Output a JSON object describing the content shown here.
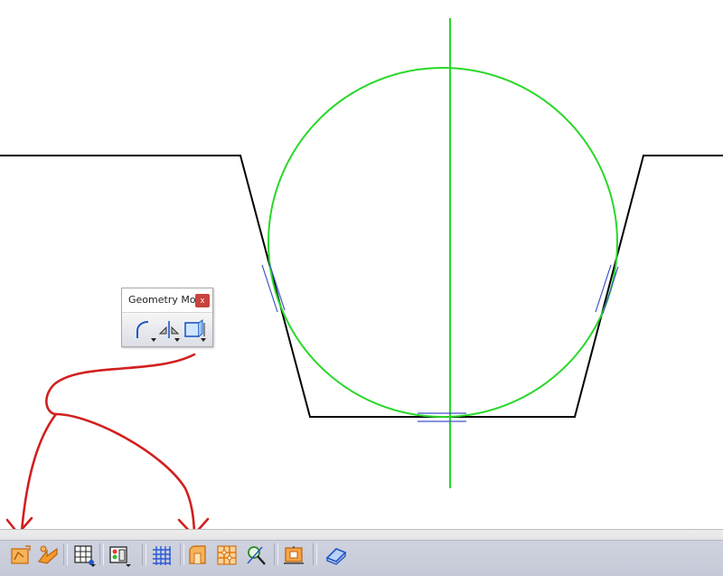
{
  "geometry_toolbar": {
    "title": "Geometry Mo...",
    "close_glyph": "x",
    "tools": [
      "curve-tool-icon",
      "symmetry-tool-icon",
      "box-tool-icon"
    ]
  },
  "bottom_toolbar": {
    "tools": [
      "orange-sketch-icon",
      "orange-ramp-icon",
      "grid-tree-icon",
      "traffic-cube-icon",
      "blue-grid-icon",
      "orange-profile-icon",
      "orange-lattice-icon",
      "magnifier-edit-icon",
      "orange-plot-icon",
      "blue-book-icon"
    ]
  },
  "colors": {
    "profile_line": "#000000",
    "circle": "#28d828",
    "centerline": "#28d828",
    "constraint_marks": "#3f51c9",
    "annotation": "#d21f1f",
    "close_button": "#c9433d"
  }
}
